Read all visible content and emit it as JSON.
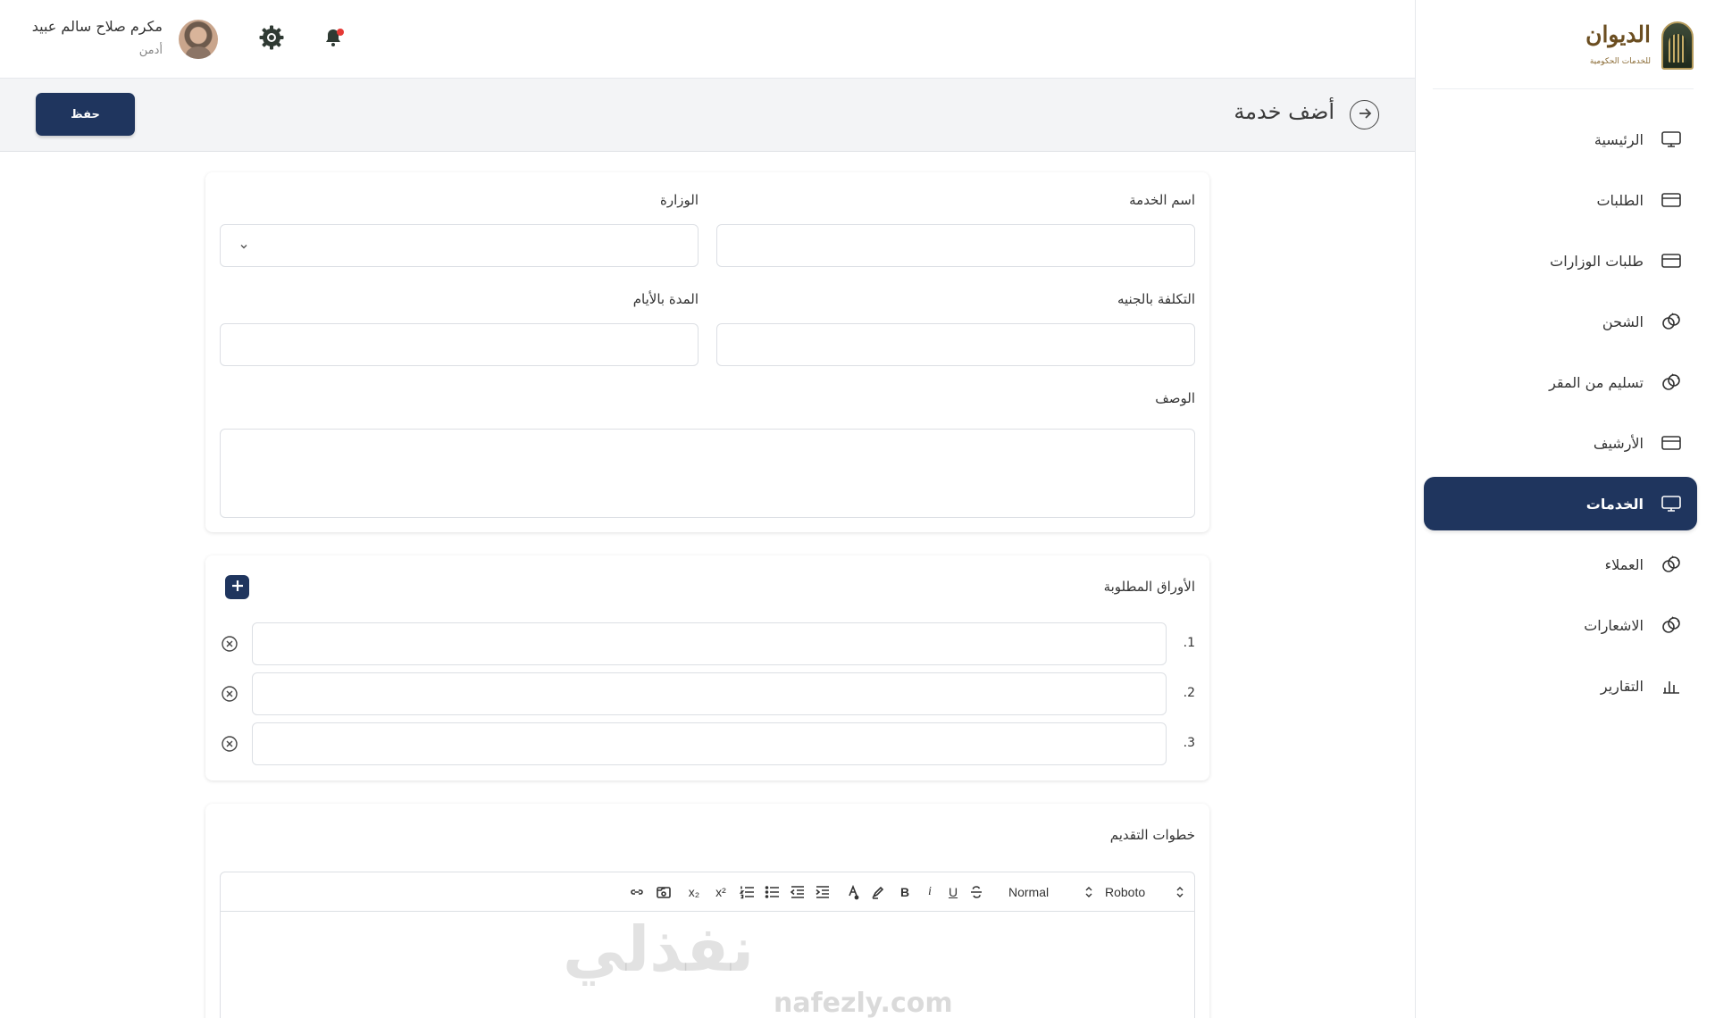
{
  "brand": {
    "title": "الديوان",
    "subtitle": "للخدمات الحكومية"
  },
  "sidebar": {
    "items": [
      {
        "label": "الرئيسية",
        "icon": "monitor-icon",
        "active": false
      },
      {
        "label": "الطلبات",
        "icon": "card-icon",
        "active": false
      },
      {
        "label": "طلبات الوزارات",
        "icon": "card-icon",
        "active": false
      },
      {
        "label": "الشحن",
        "icon": "link-circles-icon",
        "active": false
      },
      {
        "label": "تسليم من المقر",
        "icon": "link-circles-icon",
        "active": false
      },
      {
        "label": "الأرشيف",
        "icon": "card-icon",
        "active": false
      },
      {
        "label": "الخدمات",
        "icon": "monitor-icon",
        "active": true
      },
      {
        "label": "العملاء",
        "icon": "link-circles-icon",
        "active": false
      },
      {
        "label": "الاشعارات",
        "icon": "link-circles-icon",
        "active": false
      },
      {
        "label": "التقارير",
        "icon": "bar-chart-icon",
        "active": false
      }
    ]
  },
  "user": {
    "name": "مكرم صلاح سالم عبيد",
    "role": "أدمن"
  },
  "header": {
    "title": "أضف خدمة",
    "save_label": "حفظ"
  },
  "form": {
    "service_name_label": "اسم الخدمة",
    "ministry_label": "الوزارة",
    "cost_label": "التكلفة بالجنيه",
    "duration_label": "المدة بالأيام",
    "description_label": "الوصف",
    "service_name_value": "",
    "ministry_value": "",
    "cost_value": "",
    "duration_value": "",
    "description_value": ""
  },
  "documents": {
    "title": "الأوراق المطلوبة",
    "rows": [
      {
        "number": ".1",
        "value": ""
      },
      {
        "number": ".2",
        "value": ""
      },
      {
        "number": ".3",
        "value": ""
      }
    ]
  },
  "steps": {
    "title": "خطوات التقديم",
    "toolbar": {
      "font": "Roboto",
      "size": "Normal"
    }
  },
  "watermark": {
    "arabic": "نفذلي",
    "latin": "nafezly.com"
  },
  "colors": {
    "primary": "#1f355e",
    "notification_dot": "#e53935",
    "brand_gold": "#6b4e21"
  }
}
